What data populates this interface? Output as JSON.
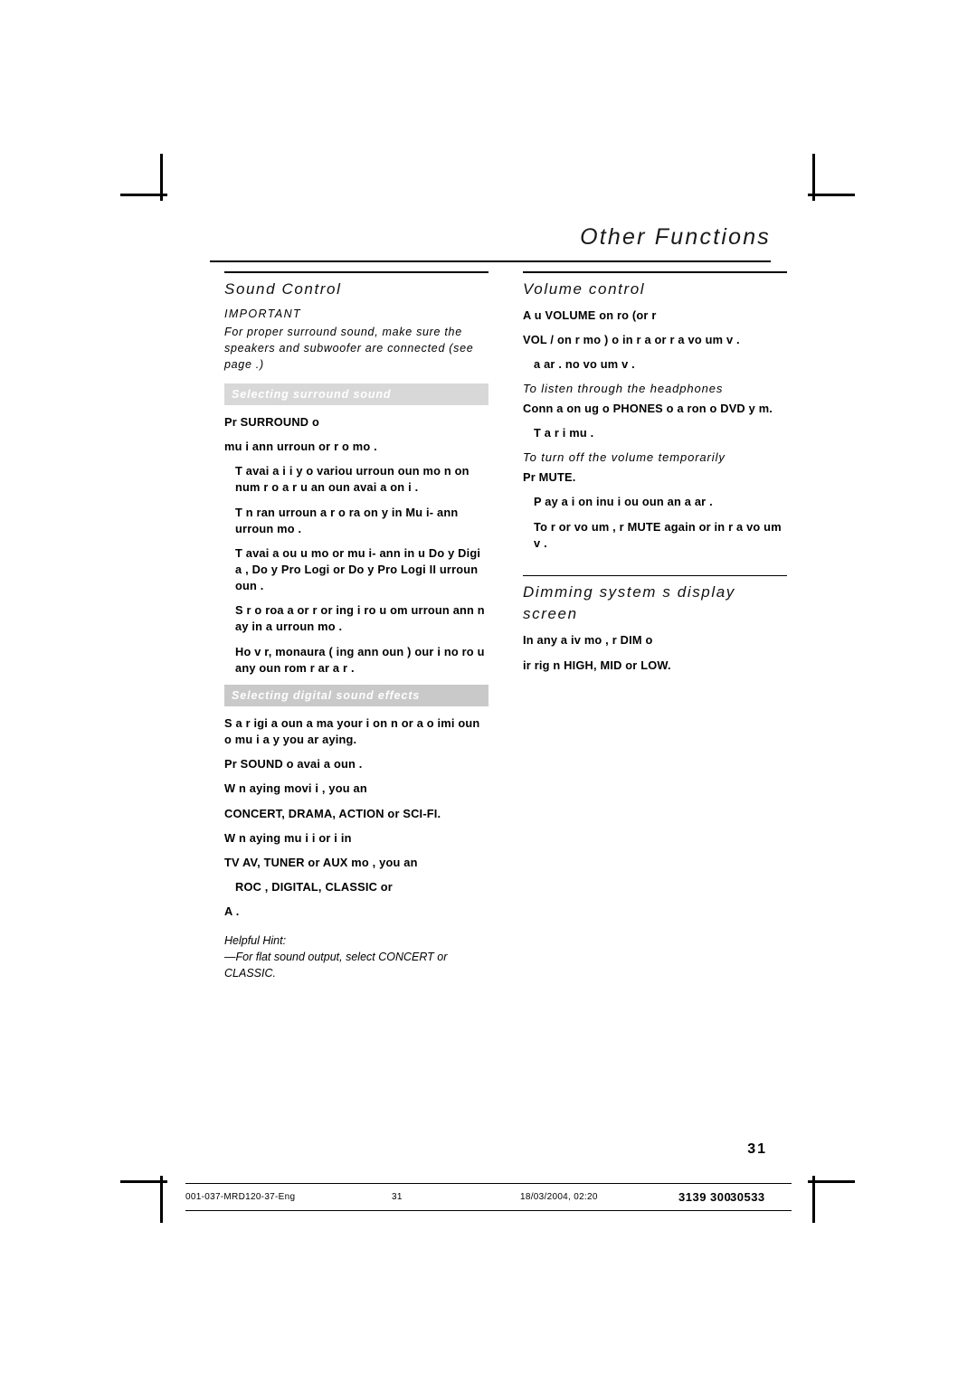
{
  "page": {
    "title": "Other Functions",
    "number": "31"
  },
  "left_column": {
    "sound_control": {
      "heading": "Sound Control",
      "important_label": "IMPORTANT",
      "important_body": "For proper surround sound, make sure the speakers and subwoofer are connected (see page  .)",
      "surround_bar": "Selecting surround sound",
      "paragraphs": [
        "Pr    SURROUND  o",
        "mu  i   ann   urroun   or    r o mo  .",
        "T   avai a i i y o       variou   urroun   oun  mo         n   on    num   r o   a  r u    an        oun  avai a    on   i  .",
        "T    n  ran   urroun      a  r o  ra   on y in Mu  i-  ann    urroun  mo  .",
        "T   avai a    ou  u  mo       or mu  i- ann   in u    Do  y Digi a , Do  y Pro Logi  or Do  y Pro Logi  II  urroun   oun .",
        "S   r o  roa    a   or r  or ing   i   ro u   om   urroun    ann     n   ay   in a  urroun  mo   .",
        "Ho   v  r, monaura  ( ing      ann    oun )  our      i  no   ro u   any   oun   rom    r  ar    a  r ."
      ],
      "digital_bar": "Selecting digital sound effects",
      "digital_paragraphs": [
        "S   a  r    igi a   oun          a    ma       your  i  on  n or    a    o   imi        oun  o      mu  i a   y  you ar    aying.",
        "Pr    SOUND  o                avai a     oun   .",
        "W   n   aying movi   i  , you  an",
        "CONCERT, DRAMA, ACTION or SCI-FI.",
        "W   n   aying mu  i  i    or    i  in",
        "TV AV, TUNER or AUX mo   , you  an",
        "ROC  , DIGITAL, CLASSIC or",
        "A   ."
      ],
      "hint_label": "Helpful Hint:",
      "hint_body": "—For flat sound output, select CONCERT or CLASSIC."
    }
  },
  "right_column": {
    "volume_control": {
      "heading": "Volume control",
      "paragraphs": [
        "A  u  VOLUME  on ro  (or   r",
        "VOL  /   on     r mo  )  o in r a    or    r a       vo um    v .",
        "a   ar .     no    vo um    v .",
        "To listen through the headphones",
        "Conn             a   on    ug o   PHONES  o    a      ron  o   DVD  y   m.",
        "T       a  r  i    mu  .",
        "To turn off the volume temporarily",
        "Pr   MUTE.",
        "P  ay a   i  on inu    i   ou   oun   an      a    ar .",
        "To r   or      vo um , r    MUTE  again or in r a         vo um    v ."
      ]
    },
    "dimming": {
      "heading_line1": "Dimming system s display",
      "heading_line2": "screen",
      "paragraphs": [
        "In any a  iv  mo   , r   DIM  o",
        " ir    rig  n     HIGH, MID or LOW."
      ]
    }
  },
  "footer": {
    "left": "001-037-MRD120-37-Eng",
    "middle": "31",
    "date": "18/03/2004, 02:20",
    "code1": "3139 300",
    "code2": "30533"
  }
}
